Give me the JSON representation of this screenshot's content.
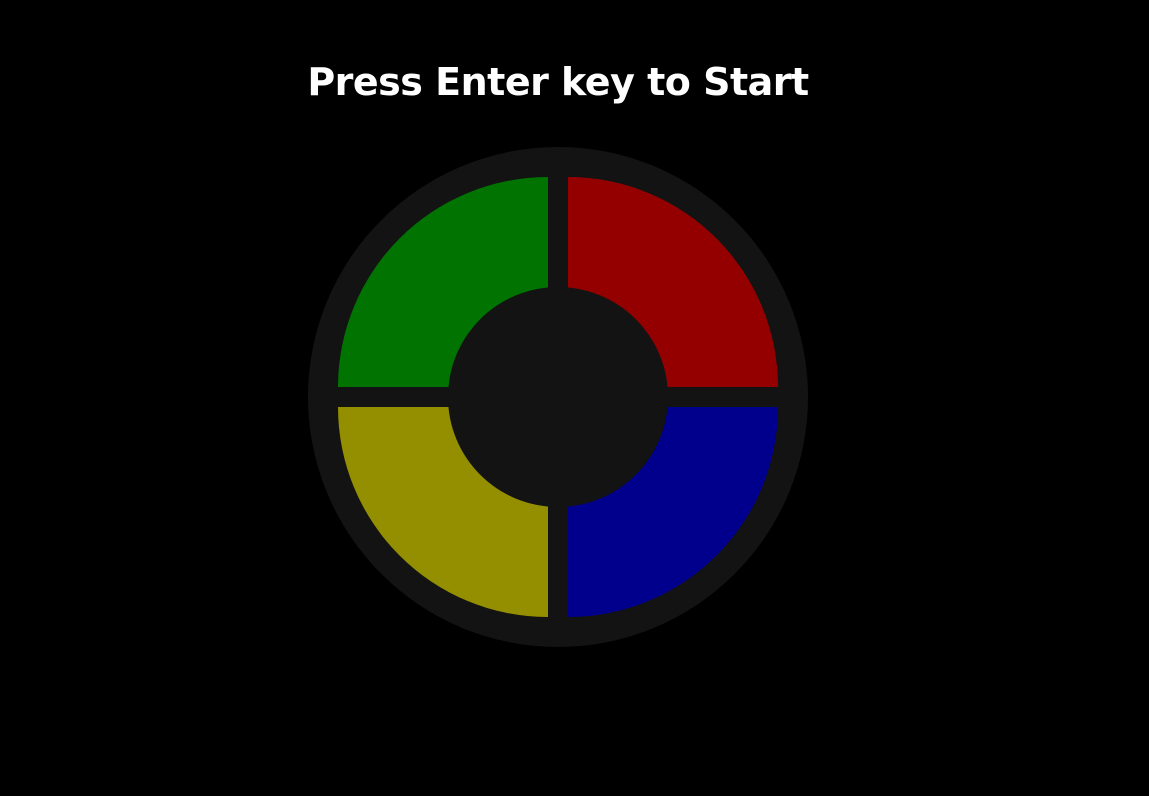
{
  "header": {
    "title": "Press Enter key to Start"
  },
  "board": {
    "background_color": "#131313",
    "pads": [
      {
        "name": "green",
        "color": "#007300"
      },
      {
        "name": "red",
        "color": "#940000"
      },
      {
        "name": "yellow",
        "color": "#948f00"
      },
      {
        "name": "blue",
        "color": "#00008d"
      }
    ],
    "hub_color": "#131313"
  },
  "page": {
    "background_color": "#000000"
  }
}
